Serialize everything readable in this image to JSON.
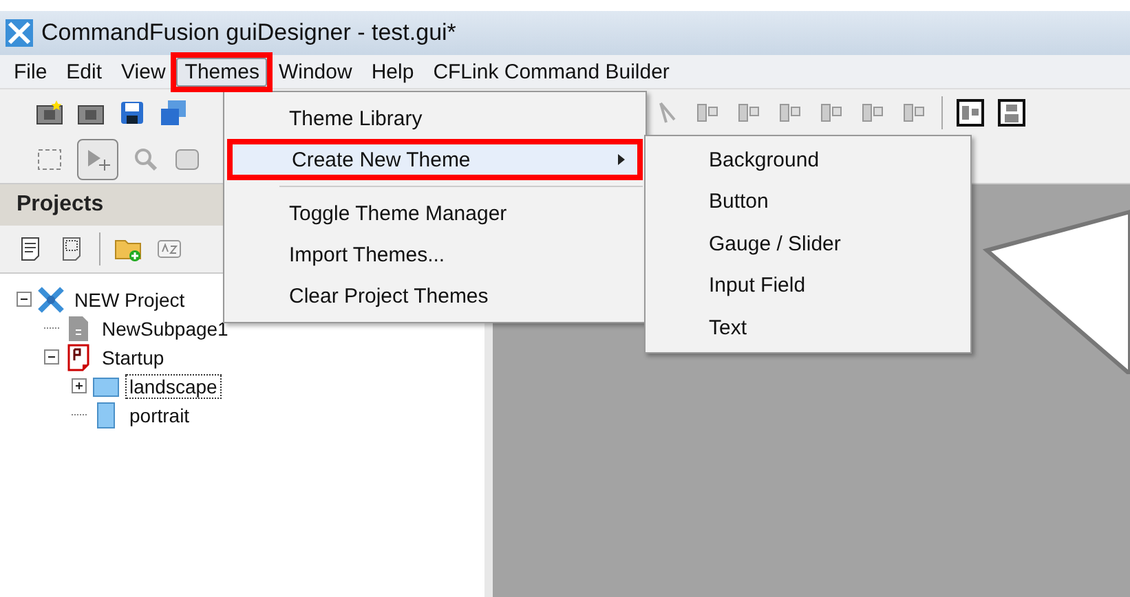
{
  "window": {
    "title": "CommandFusion guiDesigner - test.gui*"
  },
  "menubar": [
    {
      "label": "File",
      "selected": false
    },
    {
      "label": "Edit",
      "selected": false
    },
    {
      "label": "View",
      "selected": false
    },
    {
      "label": "Themes",
      "selected": true
    },
    {
      "label": "Window",
      "selected": false
    },
    {
      "label": "Help",
      "selected": false
    },
    {
      "label": "CFLink Command Builder",
      "selected": false
    }
  ],
  "themes_menu": [
    {
      "kind": "item",
      "label": "Theme Library",
      "highlighted": false,
      "submenu": false
    },
    {
      "kind": "item",
      "label": "Create New Theme",
      "highlighted": true,
      "submenu": true
    },
    {
      "kind": "separator"
    },
    {
      "kind": "item",
      "label": "Toggle Theme Manager",
      "highlighted": false,
      "submenu": false
    },
    {
      "kind": "item",
      "label": "Import Themes...",
      "highlighted": false,
      "submenu": false
    },
    {
      "kind": "item",
      "label": "Clear Project Themes",
      "highlighted": false,
      "submenu": false
    }
  ],
  "submenu": [
    "Background",
    "Button",
    "Gauge / Slider",
    "Input Field",
    "Text"
  ],
  "projects": {
    "title": "Projects",
    "tree": [
      {
        "kind": "project",
        "label": "NEW Project",
        "expanded": true,
        "focused": false,
        "children": [
          {
            "kind": "subpage",
            "label": "NewSubpage1",
            "focused": false
          },
          {
            "kind": "page",
            "label": "Startup",
            "expanded": true,
            "focused": false,
            "children": [
              {
                "kind": "landscape",
                "label": "landscape",
                "expanded": false,
                "focused": true
              },
              {
                "kind": "portrait",
                "label": "portrait",
                "focused": false
              }
            ]
          }
        ]
      }
    ]
  }
}
